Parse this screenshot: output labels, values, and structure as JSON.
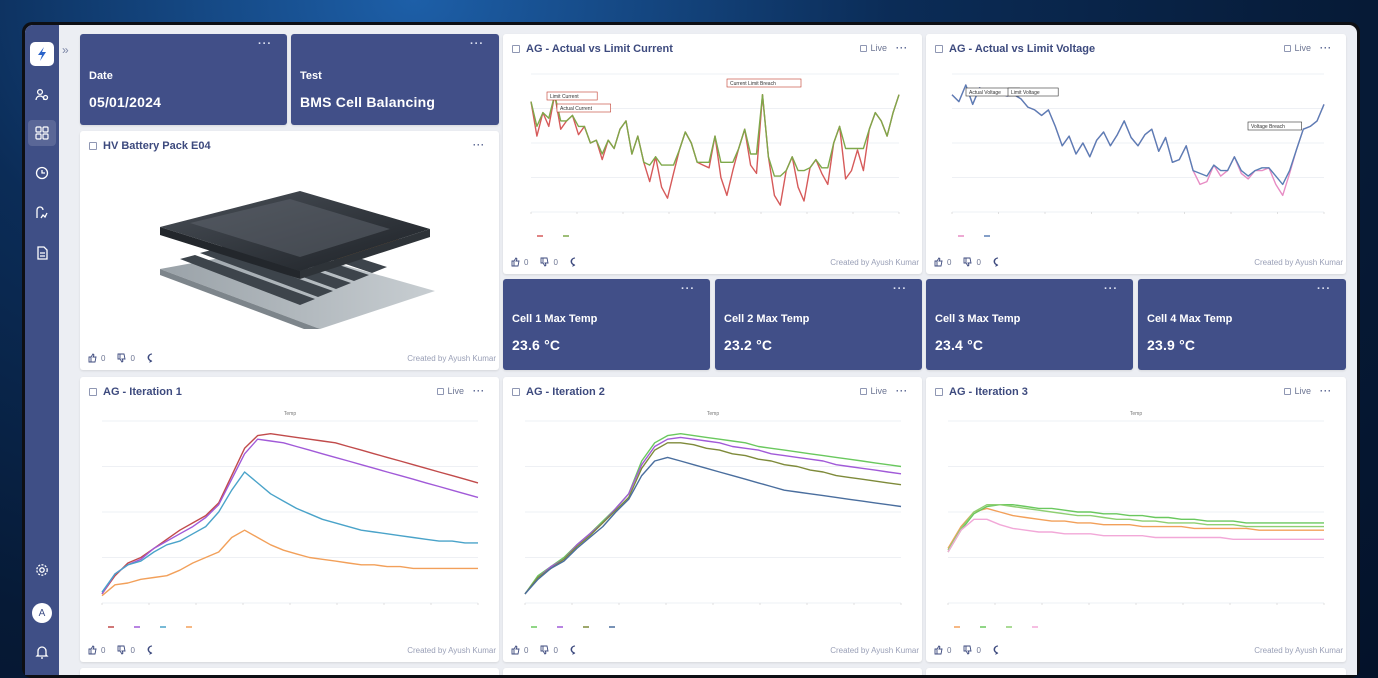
{
  "colors": {
    "sidebar": "#3f4f86",
    "kpi_bg": "#414f88",
    "title": "#3d4a7e"
  },
  "sidebar": {
    "icons": [
      "logo-icon",
      "users-icon",
      "dashboard-icon",
      "history-icon",
      "report-icon",
      "document-icon",
      "settings-icon",
      "bell-icon"
    ],
    "avatar_letter": "A"
  },
  "kpis": {
    "date": {
      "label": "Date",
      "value": "05/01/2024"
    },
    "test": {
      "label": "Test",
      "value": "BMS Cell Balancing"
    },
    "cell1": {
      "label": "Cell 1 Max Temp",
      "value": "23.6 °C"
    },
    "cell2": {
      "label": "Cell 2 Max Temp",
      "value": "23.2 °C"
    },
    "cell3": {
      "label": "Cell 3 Max Temp",
      "value": "23.4 °C"
    },
    "cell4": {
      "label": "Cell 4 Max Temp",
      "value": "23.9 °C"
    }
  },
  "common": {
    "more": "···",
    "live": "Live",
    "likes": "0",
    "dislikes": "0",
    "created_by": "Created by Ayush Kumar"
  },
  "cards": {
    "battery": {
      "title": "HV Battery Pack E04"
    },
    "current": {
      "title": "AG - Actual vs Limit Current"
    },
    "voltage": {
      "title": "AG - Actual vs Limit Voltage"
    },
    "iter1": {
      "title": "AG - Iteration 1"
    },
    "iter2": {
      "title": "AG - Iteration 2"
    },
    "iter3": {
      "title": "AG - Iteration 3"
    }
  },
  "chart_data": [
    {
      "id": "current",
      "type": "line",
      "ylim": [
        0,
        1
      ],
      "annotations": [
        "Limit Current",
        "Actual Current",
        "Current Limit Breach"
      ],
      "series": [
        {
          "color": "#d65a5a",
          "values": [
            0.8,
            0.55,
            0.72,
            0.62,
            0.85,
            0.6,
            0.66,
            0.7,
            0.56,
            0.62,
            0.5,
            0.52,
            0.38,
            0.52,
            0.46,
            0.6,
            0.66,
            0.42,
            0.55,
            0.36,
            0.22,
            0.4,
            0.18,
            0.1,
            0.28,
            0.45,
            0.58,
            0.5,
            0.36,
            0.34,
            0.32,
            0.55,
            0.25,
            0.12,
            0.3,
            0.46,
            0.6,
            0.34,
            0.28,
            0.85,
            0.4,
            0.12,
            0.05,
            0.3,
            0.4,
            0.18,
            0.08,
            0.32,
            0.38,
            0.28,
            0.2,
            0.5,
            0.62,
            0.24,
            0.3,
            0.45,
            0.3,
            0.6,
            0.72,
            0.66,
            0.55,
            0.72,
            0.85
          ]
        },
        {
          "color": "#7ea84a",
          "values": [
            0.8,
            0.62,
            0.72,
            0.68,
            0.85,
            0.66,
            0.66,
            0.7,
            0.62,
            0.62,
            0.5,
            0.52,
            0.42,
            0.52,
            0.46,
            0.6,
            0.66,
            0.42,
            0.55,
            0.36,
            0.34,
            0.4,
            0.34,
            0.34,
            0.34,
            0.45,
            0.58,
            0.5,
            0.36,
            0.36,
            0.36,
            0.55,
            0.36,
            0.36,
            0.36,
            0.46,
            0.6,
            0.42,
            0.42,
            0.85,
            0.4,
            0.26,
            0.26,
            0.3,
            0.4,
            0.3,
            0.3,
            0.32,
            0.38,
            0.32,
            0.32,
            0.5,
            0.62,
            0.46,
            0.46,
            0.46,
            0.46,
            0.6,
            0.72,
            0.66,
            0.55,
            0.72,
            0.85
          ]
        }
      ]
    },
    {
      "id": "voltage",
      "type": "line",
      "ylim": [
        0,
        1
      ],
      "annotations": [
        "Actual Voltage",
        "Limit Voltage",
        "Voltage Breach"
      ],
      "series": [
        {
          "color": "#e78cc4",
          "values": [
            0.85,
            0.8,
            0.92,
            0.78,
            0.9,
            0.86,
            0.88,
            0.86,
            0.84,
            0.85,
            0.82,
            0.76,
            0.74,
            0.7,
            0.74,
            0.62,
            0.48,
            0.55,
            0.42,
            0.5,
            0.4,
            0.52,
            0.58,
            0.48,
            0.56,
            0.66,
            0.54,
            0.48,
            0.56,
            0.6,
            0.44,
            0.54,
            0.36,
            0.38,
            0.48,
            0.3,
            0.2,
            0.22,
            0.34,
            0.26,
            0.3,
            0.4,
            0.28,
            0.24,
            0.3,
            0.3,
            0.32,
            0.2,
            0.12,
            0.28,
            0.45,
            0.6,
            0.62,
            0.66,
            0.78
          ]
        },
        {
          "color": "#5a7fb5",
          "values": [
            0.85,
            0.8,
            0.92,
            0.78,
            0.9,
            0.86,
            0.88,
            0.86,
            0.84,
            0.85,
            0.82,
            0.76,
            0.74,
            0.7,
            0.74,
            0.62,
            0.48,
            0.55,
            0.42,
            0.5,
            0.4,
            0.52,
            0.58,
            0.48,
            0.56,
            0.66,
            0.54,
            0.48,
            0.56,
            0.6,
            0.44,
            0.54,
            0.36,
            0.38,
            0.48,
            0.3,
            0.28,
            0.26,
            0.34,
            0.3,
            0.3,
            0.4,
            0.3,
            0.26,
            0.3,
            0.32,
            0.32,
            0.26,
            0.2,
            0.3,
            0.45,
            0.6,
            0.62,
            0.66,
            0.78
          ]
        }
      ]
    },
    {
      "id": "iter1",
      "type": "line",
      "title": "Temp",
      "ylim": [
        0,
        1
      ],
      "series": [
        {
          "color": "#c14b4b",
          "values": [
            0.05,
            0.15,
            0.22,
            0.25,
            0.3,
            0.35,
            0.4,
            0.44,
            0.48,
            0.55,
            0.7,
            0.85,
            0.92,
            0.93,
            0.92,
            0.91,
            0.9,
            0.89,
            0.88,
            0.86,
            0.84,
            0.82,
            0.8,
            0.78,
            0.76,
            0.74,
            0.72,
            0.7,
            0.68,
            0.66
          ]
        },
        {
          "color": "#a15ad8",
          "values": [
            0.05,
            0.16,
            0.21,
            0.24,
            0.3,
            0.34,
            0.38,
            0.42,
            0.47,
            0.54,
            0.68,
            0.82,
            0.9,
            0.89,
            0.88,
            0.86,
            0.84,
            0.82,
            0.8,
            0.78,
            0.76,
            0.74,
            0.72,
            0.7,
            0.68,
            0.66,
            0.64,
            0.62,
            0.6,
            0.58
          ]
        },
        {
          "color": "#4aa3c9",
          "values": [
            0.06,
            0.16,
            0.21,
            0.23,
            0.28,
            0.32,
            0.34,
            0.38,
            0.42,
            0.5,
            0.62,
            0.72,
            0.66,
            0.6,
            0.56,
            0.52,
            0.49,
            0.46,
            0.44,
            0.42,
            0.4,
            0.39,
            0.38,
            0.37,
            0.36,
            0.35,
            0.34,
            0.34,
            0.33,
            0.33
          ]
        },
        {
          "color": "#f2a05a",
          "values": [
            0.04,
            0.1,
            0.11,
            0.13,
            0.14,
            0.15,
            0.18,
            0.22,
            0.25,
            0.28,
            0.36,
            0.4,
            0.36,
            0.32,
            0.29,
            0.27,
            0.25,
            0.24,
            0.23,
            0.22,
            0.21,
            0.21,
            0.2,
            0.2,
            0.19,
            0.19,
            0.19,
            0.19,
            0.19,
            0.19
          ]
        }
      ]
    },
    {
      "id": "iter2",
      "type": "line",
      "title": "Temp",
      "ylim": [
        0,
        1
      ],
      "series": [
        {
          "color": "#6ac85e",
          "values": [
            0.05,
            0.15,
            0.2,
            0.25,
            0.32,
            0.38,
            0.45,
            0.52,
            0.6,
            0.78,
            0.88,
            0.92,
            0.93,
            0.92,
            0.91,
            0.9,
            0.89,
            0.88,
            0.86,
            0.85,
            0.84,
            0.83,
            0.82,
            0.81,
            0.8,
            0.79,
            0.78,
            0.77,
            0.76,
            0.75
          ]
        },
        {
          "color": "#a15ad8",
          "values": [
            0.05,
            0.14,
            0.2,
            0.24,
            0.32,
            0.38,
            0.44,
            0.52,
            0.6,
            0.76,
            0.86,
            0.9,
            0.91,
            0.9,
            0.89,
            0.88,
            0.86,
            0.85,
            0.84,
            0.82,
            0.81,
            0.8,
            0.79,
            0.78,
            0.76,
            0.75,
            0.74,
            0.73,
            0.72,
            0.71
          ]
        },
        {
          "color": "#7e8a3a",
          "values": [
            0.05,
            0.14,
            0.19,
            0.24,
            0.31,
            0.37,
            0.44,
            0.51,
            0.58,
            0.74,
            0.84,
            0.88,
            0.88,
            0.87,
            0.85,
            0.84,
            0.82,
            0.81,
            0.79,
            0.78,
            0.76,
            0.75,
            0.73,
            0.72,
            0.7,
            0.69,
            0.68,
            0.67,
            0.66,
            0.65
          ]
        },
        {
          "color": "#4a6e9e",
          "values": [
            0.05,
            0.13,
            0.19,
            0.23,
            0.3,
            0.36,
            0.42,
            0.5,
            0.57,
            0.7,
            0.78,
            0.8,
            0.78,
            0.76,
            0.74,
            0.72,
            0.7,
            0.68,
            0.66,
            0.64,
            0.62,
            0.61,
            0.6,
            0.59,
            0.58,
            0.57,
            0.56,
            0.55,
            0.54,
            0.53
          ]
        }
      ]
    },
    {
      "id": "iter3",
      "type": "line",
      "title": "Temp",
      "ylim": [
        0,
        1
      ],
      "series": [
        {
          "color": "#f2a05a",
          "values": [
            0.3,
            0.42,
            0.5,
            0.52,
            0.5,
            0.48,
            0.47,
            0.46,
            0.45,
            0.45,
            0.44,
            0.44,
            0.43,
            0.43,
            0.43,
            0.42,
            0.42,
            0.42,
            0.42,
            0.41,
            0.41,
            0.41,
            0.41,
            0.41,
            0.4,
            0.4,
            0.4,
            0.4,
            0.4,
            0.4
          ]
        },
        {
          "color": "#6ac85e",
          "values": [
            0.28,
            0.4,
            0.49,
            0.53,
            0.54,
            0.54,
            0.53,
            0.52,
            0.52,
            0.51,
            0.5,
            0.5,
            0.49,
            0.49,
            0.48,
            0.48,
            0.47,
            0.47,
            0.46,
            0.46,
            0.45,
            0.45,
            0.45,
            0.44,
            0.44,
            0.44,
            0.44,
            0.44,
            0.44,
            0.44
          ]
        },
        {
          "color": "#8ecf72",
          "values": [
            0.29,
            0.41,
            0.5,
            0.54,
            0.54,
            0.53,
            0.52,
            0.51,
            0.5,
            0.49,
            0.48,
            0.48,
            0.47,
            0.46,
            0.46,
            0.45,
            0.45,
            0.44,
            0.44,
            0.44,
            0.43,
            0.43,
            0.43,
            0.42,
            0.42,
            0.42,
            0.42,
            0.42,
            0.42,
            0.42
          ]
        },
        {
          "color": "#f2a8d8",
          "values": [
            0.28,
            0.4,
            0.46,
            0.46,
            0.43,
            0.41,
            0.4,
            0.39,
            0.39,
            0.38,
            0.38,
            0.38,
            0.37,
            0.37,
            0.37,
            0.37,
            0.36,
            0.36,
            0.36,
            0.36,
            0.36,
            0.36,
            0.35,
            0.35,
            0.35,
            0.35,
            0.35,
            0.35,
            0.35,
            0.35
          ]
        }
      ]
    }
  ]
}
